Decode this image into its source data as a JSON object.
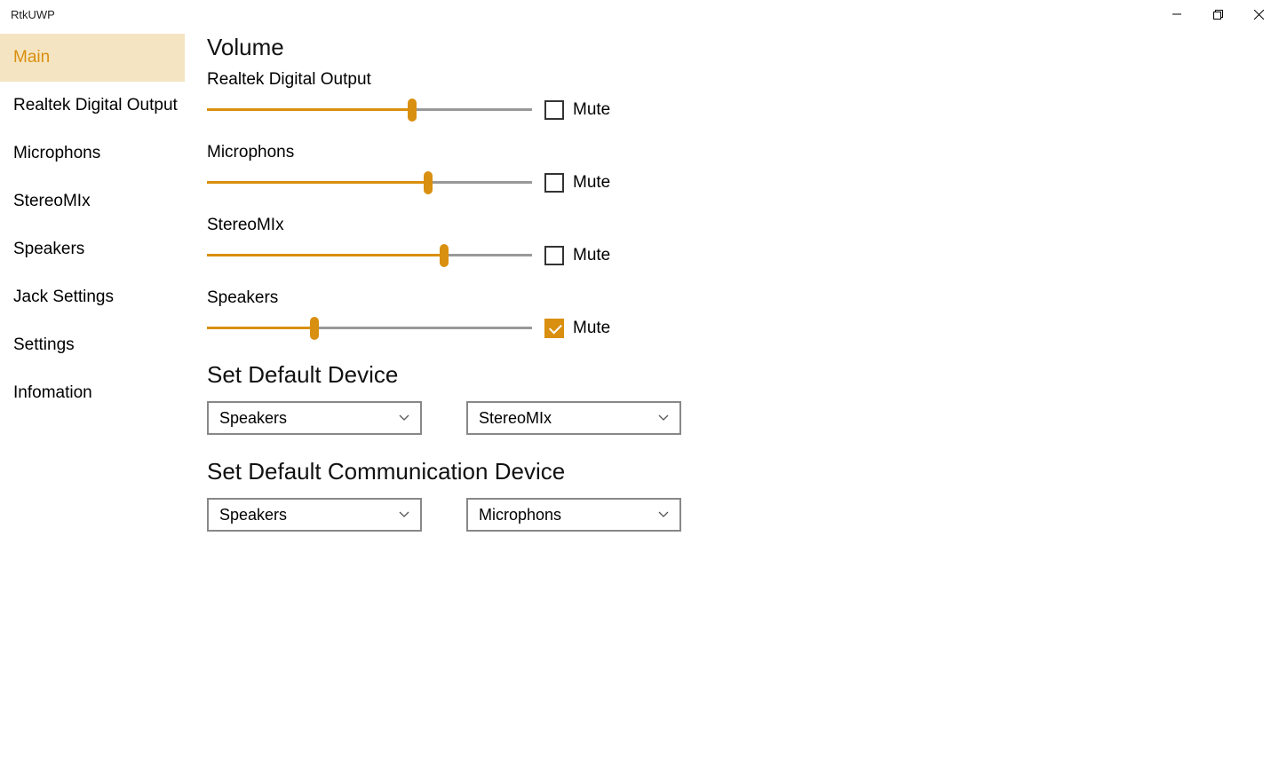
{
  "window": {
    "title": "RtkUWP"
  },
  "sidebar": {
    "items": [
      {
        "label": "Main",
        "active": true
      },
      {
        "label": "Realtek Digital Output",
        "active": false
      },
      {
        "label": "Microphons",
        "active": false
      },
      {
        "label": "StereoMIx",
        "active": false
      },
      {
        "label": "Speakers",
        "active": false
      },
      {
        "label": "Jack Settings",
        "active": false
      },
      {
        "label": "Settings",
        "active": false
      },
      {
        "label": "Infomation",
        "active": false
      }
    ]
  },
  "sections": {
    "volume_title": "Volume",
    "default_device_title": "Set Default Device",
    "default_comm_title": "Set Default Communication Device"
  },
  "volumes": [
    {
      "label": "Realtek Digital Output",
      "percent": 63,
      "muted": false,
      "mute_label": "Mute"
    },
    {
      "label": "Microphons",
      "percent": 68,
      "muted": false,
      "mute_label": "Mute"
    },
    {
      "label": "StereoMIx",
      "percent": 73,
      "muted": false,
      "mute_label": "Mute"
    },
    {
      "label": "Speakers",
      "percent": 33,
      "muted": true,
      "mute_label": "Mute"
    }
  ],
  "default_device": {
    "output": "Speakers",
    "input": "StereoMIx"
  },
  "default_comm": {
    "output": "Speakers",
    "input": "Microphons"
  },
  "colors": {
    "accent": "#d98f0f",
    "sidebar_active_bg": "#f5e4c1"
  }
}
